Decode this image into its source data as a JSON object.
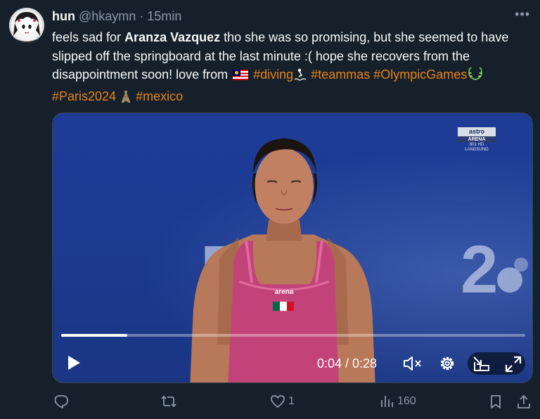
{
  "post": {
    "author": {
      "display_name": "hun",
      "handle": "@hkaymn",
      "separator": "·",
      "time": "15min"
    },
    "more_label": "•••",
    "text": {
      "p1": "feels sad for ",
      "mention": "Aranza Vazquez",
      "p2": " tho she was so promising, but she seemed to have slipped off the springboard at the last minute :( hope she recovers from the disappointment soon! love from ",
      "tags": {
        "diving": "#diving",
        "teammas": "#teammas",
        "olympics": "#OlympicGames",
        "paris": "#Paris2024",
        "mexico": "#mexico"
      }
    },
    "video": {
      "watermark": {
        "logo": "astro",
        "sub": "ARENA",
        "line1": "801 HD",
        "line2": "LANGSUNG"
      },
      "background_text_left": "RIS",
      "background_text_right": "2",
      "swimsuit_brand": "arena",
      "time_readout": "0:04 / 0:28",
      "progress": 0.1429
    },
    "actions": {
      "reply": {
        "icon": "reply-icon",
        "count": ""
      },
      "repost": {
        "icon": "repost-icon",
        "count": ""
      },
      "like": {
        "icon": "heart-icon",
        "count": "1"
      },
      "views": {
        "icon": "views-icon",
        "count": "160"
      },
      "bookmark": {
        "icon": "bookmark-icon"
      },
      "share": {
        "icon": "share-icon"
      }
    }
  },
  "colors": {
    "background": "#15202b",
    "text": "#f7f9f9",
    "muted": "#8b98a5",
    "hashtag": "#e8841a",
    "video_bg": "#1c3a91",
    "swimsuit": "#c2437a"
  }
}
